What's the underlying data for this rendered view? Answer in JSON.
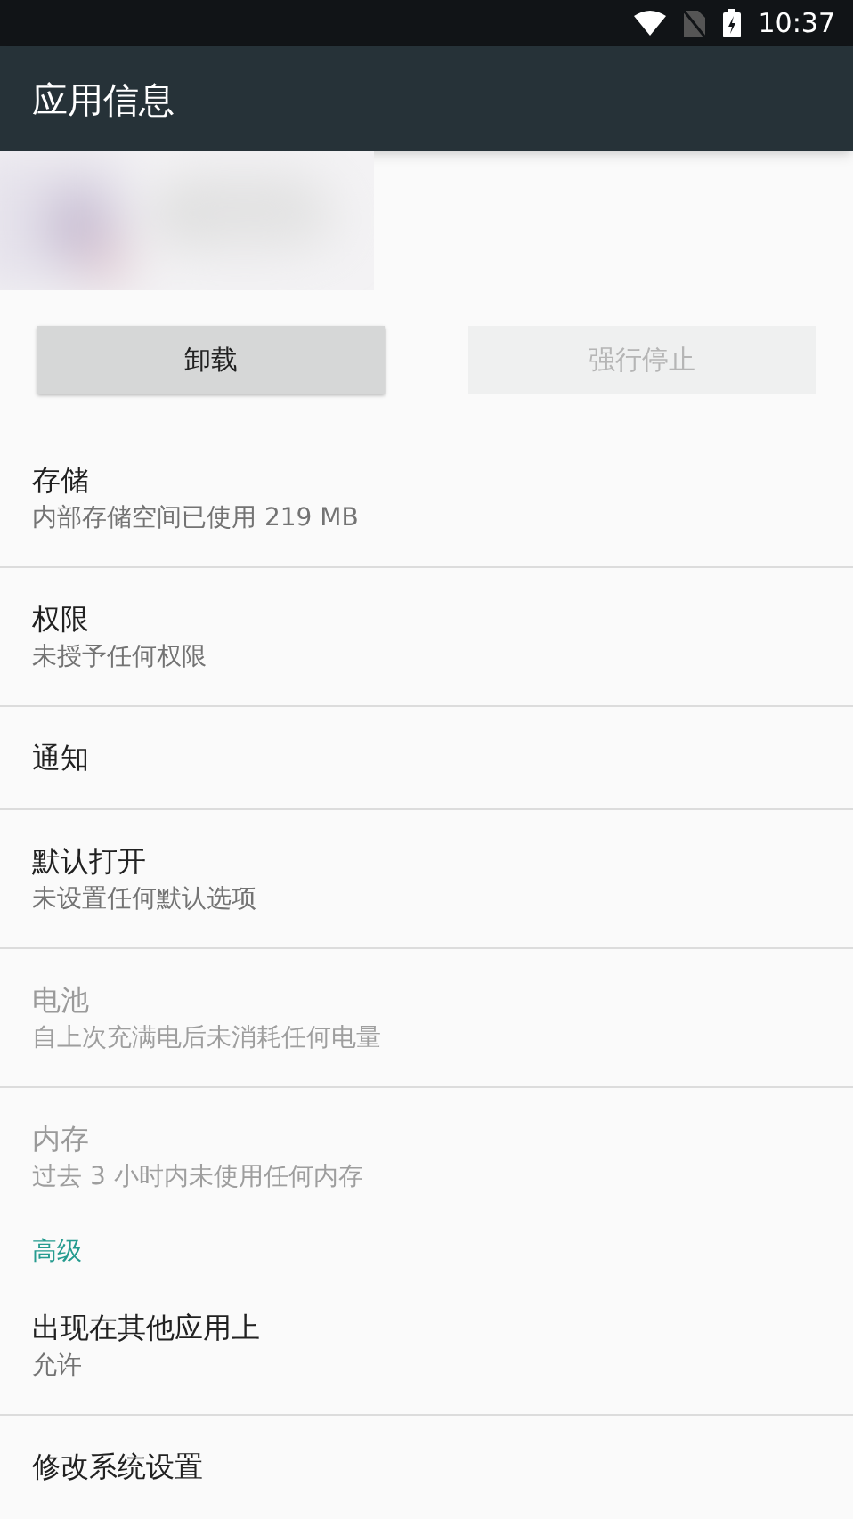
{
  "status_bar": {
    "time": "10:37"
  },
  "toolbar": {
    "title": "应用信息"
  },
  "buttons": [
    {
      "label": "卸载",
      "disabled": false
    },
    {
      "label": "强行停止",
      "disabled": true
    }
  ],
  "items": [
    {
      "kind": "item",
      "title": "存储",
      "summary": "内部存储空间已使用 219 MB",
      "disabled": false
    },
    {
      "kind": "item",
      "title": "权限",
      "summary": "未授予任何权限",
      "disabled": false
    },
    {
      "kind": "item",
      "title": "通知",
      "disabled": false
    },
    {
      "kind": "item",
      "title": "默认打开",
      "summary": "未设置任何默认选项",
      "disabled": false
    },
    {
      "kind": "item",
      "title": "电池",
      "summary": "自上次充满电后未消耗任何电量",
      "disabled": true
    },
    {
      "kind": "item",
      "title": "内存",
      "summary": "过去 3 小时内未使用任何内存",
      "disabled": true
    },
    {
      "kind": "category",
      "title": "高级"
    },
    {
      "kind": "item",
      "title": "出现在其他应用上",
      "summary": "允许",
      "disabled": false
    },
    {
      "kind": "item",
      "title": "修改系统设置",
      "disabled": false
    }
  ]
}
